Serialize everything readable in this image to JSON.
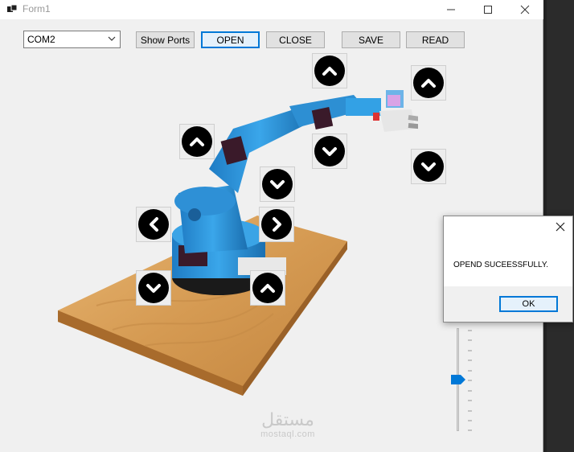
{
  "window": {
    "title": "Form1"
  },
  "titlebar_icons": {
    "minimize": "minimize-icon",
    "maximize": "maximize-icon",
    "close": "close-icon"
  },
  "toolbar": {
    "port_selected": "COM2",
    "show_ports": "Show Ports",
    "open": "OPEN",
    "close": "CLOSE",
    "save": "SAVE",
    "read": "READ"
  },
  "controls": {
    "base_left": "chevron-left-icon",
    "base_right": "chevron-right-icon",
    "base_up": "chevron-up-icon",
    "base_down": "chevron-down-icon",
    "shoulder_up": "chevron-up-icon",
    "shoulder_down": "chevron-down-icon",
    "elbow_up": "chevron-up-icon",
    "elbow_down": "chevron-down-icon",
    "gripper_up": "chevron-up-icon",
    "gripper_down": "chevron-down-icon"
  },
  "dialog": {
    "message": "OPEND SUCEESSFULLY.",
    "ok_label": "OK"
  },
  "watermark": {
    "arabic": "مستقل",
    "latin": "mostaql.com"
  },
  "colors": {
    "accent": "#0078d7",
    "arm_blue": "#2f9ae0",
    "wood": "#d9a35c"
  }
}
